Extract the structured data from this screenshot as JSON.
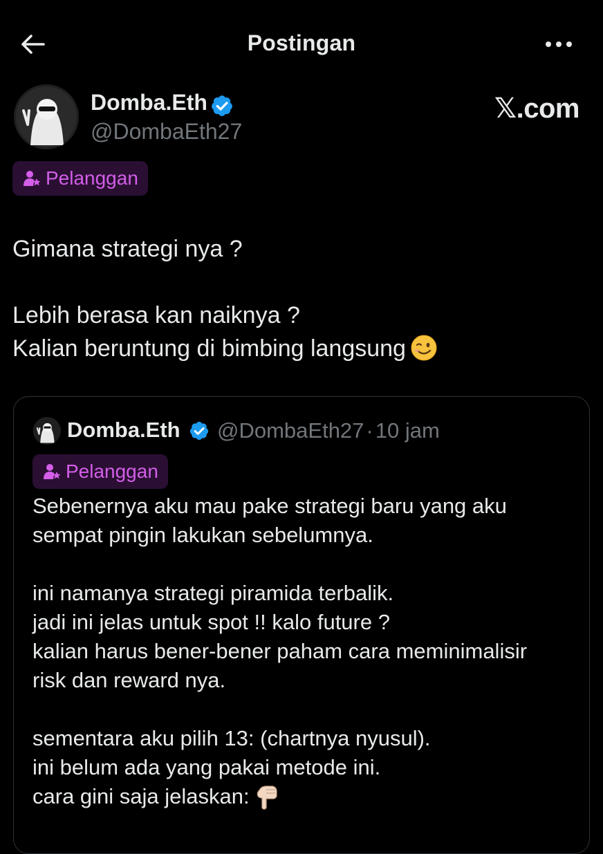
{
  "header": {
    "title": "Postingan",
    "back_icon": "arrow-left-icon",
    "more_icon": "more-horizontal-icon"
  },
  "post": {
    "author_name": "Domba.Eth",
    "author_handle": "@DombaEth27",
    "verified_icon": "verified-badge-icon",
    "watermark": "𝕏.com",
    "subscriber_badge": "Pelanggan",
    "text_lines": [
      "Gimana strategi nya ?",
      "Lebih berasa kan naiknya ?",
      "Kalian beruntung di bimbing langsung"
    ],
    "emoji": "winking-face-emoji"
  },
  "quoted_post": {
    "author_name": "Domba.Eth",
    "author_handle": "@DombaEth27",
    "separator": "·",
    "time": "10 jam",
    "subscriber_badge": "Pelanggan",
    "paragraphs": [
      [
        "Sebenernya aku mau pake strategi baru yang aku",
        "sempat pingin lakukan sebelumnya."
      ],
      [
        "ini namanya strategi piramida terbalik.",
        "jadi ini jelas untuk spot !! kalo future ?",
        "kalian harus bener-bener paham cara meminimalisir",
        "risk dan reward nya."
      ],
      [
        "sementara aku pilih 13: (chartnya nyusul).",
        "ini belum ada yang pakai metode ini.",
        "cara gini saja jelaskan:"
      ]
    ],
    "emoji": "backhand-index-pointing-down-emoji"
  },
  "colors": {
    "background": "#000000",
    "text_primary": "#e7e9ea",
    "text_secondary": "#71767b",
    "verified_blue": "#1d9bf0",
    "badge_bg": "#2a0f33",
    "badge_text": "#d35ee8",
    "card_border": "#2f3336"
  }
}
